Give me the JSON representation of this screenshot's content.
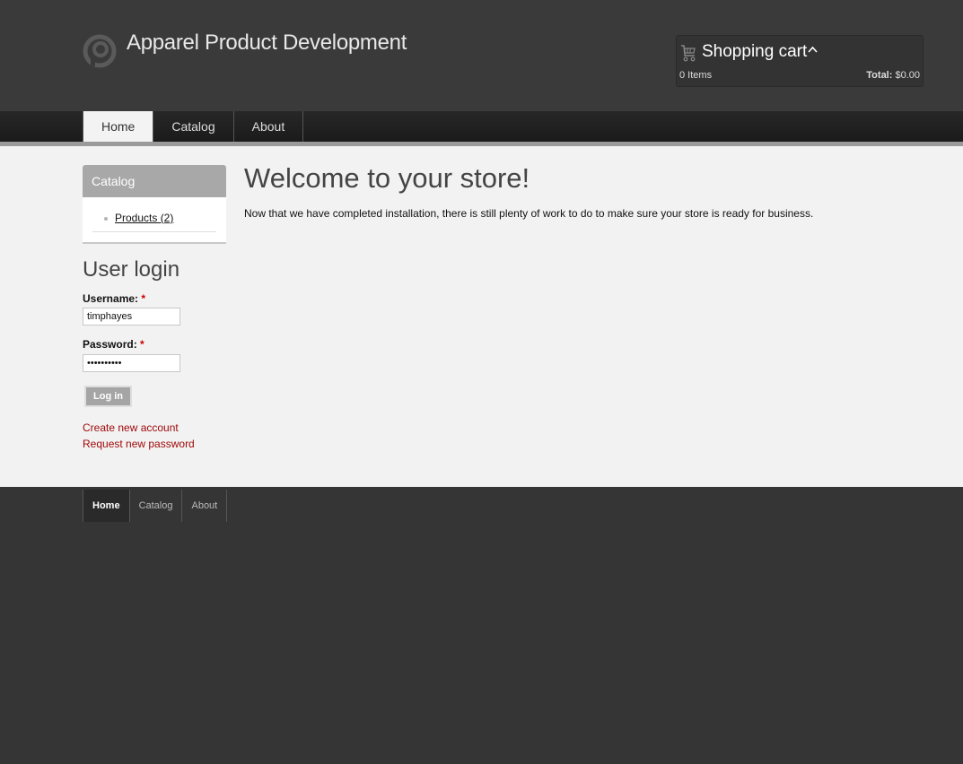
{
  "site": {
    "name": "Apparel Product Development",
    "logo_icon": "drupal-logo-icon"
  },
  "cart": {
    "icon": "cart-icon",
    "title": "Shopping cart",
    "toggle_icon": "chevron-up-icon",
    "items_text": "0 Items",
    "total_label": "Total:",
    "total_value": "$0.00"
  },
  "nav": {
    "items": [
      {
        "label": "Home",
        "active": true
      },
      {
        "label": "Catalog",
        "active": false
      },
      {
        "label": "About",
        "active": false
      }
    ]
  },
  "sidebar": {
    "catalog": {
      "title": "Catalog",
      "items": [
        {
          "label": "Products (2)"
        }
      ]
    },
    "login": {
      "title": "User login",
      "username_label": "Username:",
      "username_value": "timphayes",
      "password_label": "Password:",
      "password_value": "••••••••••",
      "required_marker": "*",
      "submit_label": "Log in",
      "create_account": "Create new account",
      "request_password": "Request new password"
    }
  },
  "content": {
    "title": "Welcome to your store!",
    "body": "Now that we have completed installation, there is still plenty of work to do to make sure your store is ready for business."
  },
  "footer": {
    "items": [
      {
        "label": "Home",
        "active": true
      },
      {
        "label": "Catalog",
        "active": false
      },
      {
        "label": "About",
        "active": false
      }
    ]
  },
  "colors": {
    "link": "#a0090a",
    "header_bg": "#3a3a3a",
    "content_bg": "#f2f2f2"
  }
}
